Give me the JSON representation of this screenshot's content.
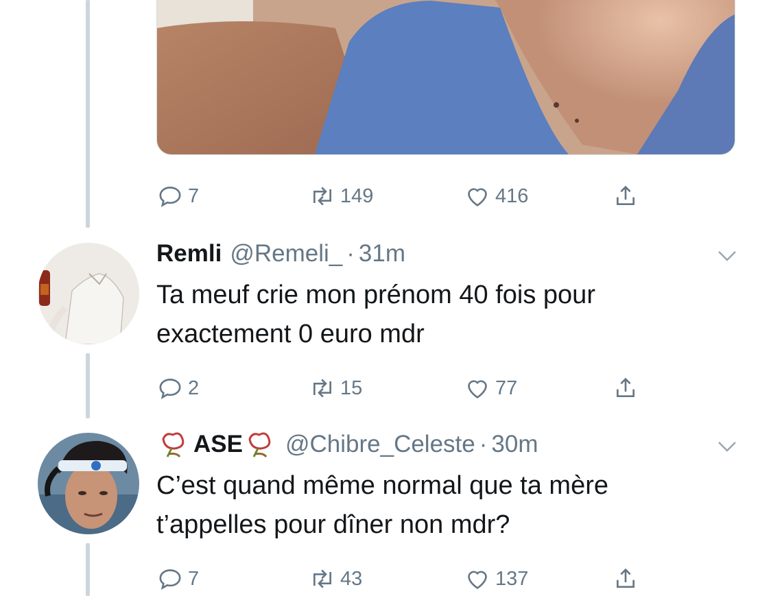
{
  "tweets": [
    {
      "actions": {
        "replies": "7",
        "retweets": "149",
        "likes": "416"
      }
    },
    {
      "name": "Remli",
      "handle": "@Remeli_",
      "time": "31m",
      "text_line1": "Ta meuf crie mon prénom 40 fois pour",
      "text_line2": "exactement 0 euro mdr",
      "actions": {
        "replies": "2",
        "retweets": "15",
        "likes": "77"
      }
    },
    {
      "name": "ASE",
      "handle": "@Chibre_Celeste",
      "time": "30m",
      "text_line1": "C’est quand même normal que ta mère",
      "text_line2": "t’appelles pour dîner non mdr?",
      "actions": {
        "replies": "7",
        "retweets": "43",
        "likes": "137"
      }
    }
  ],
  "separator": "·",
  "colors": {
    "muted": "#657786",
    "text": "#14171a",
    "thread": "#cdd5dd"
  }
}
